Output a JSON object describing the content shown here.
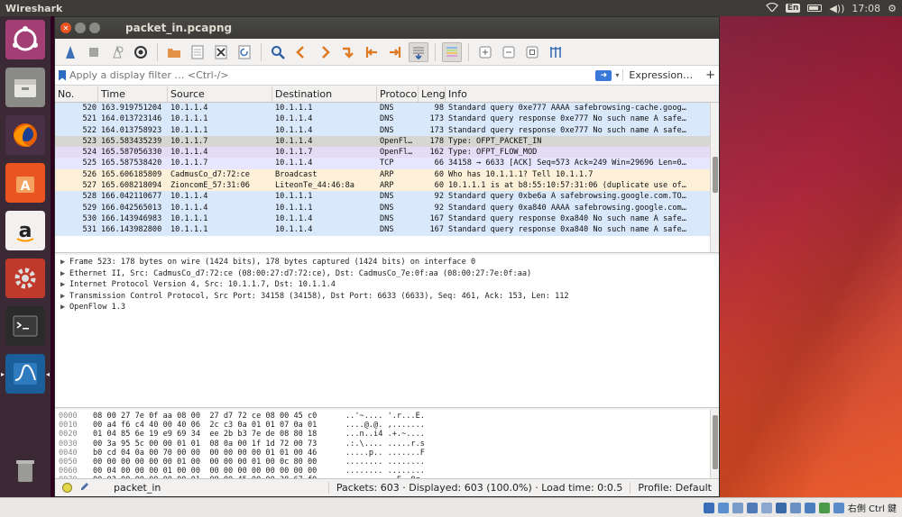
{
  "top_panel": {
    "app_name": "Wireshark",
    "keyboard": "En",
    "volume": "◀))",
    "time": "17:08",
    "settings": "⚙"
  },
  "window": {
    "title": "packet_in.pcapng"
  },
  "filter": {
    "placeholder": "Apply a display filter … <Ctrl-/>",
    "expression_label": "Expression…",
    "plus_label": "+"
  },
  "packet_list": {
    "columns": [
      "No.",
      "Time",
      "Source",
      "Destination",
      "Protocol",
      "Length",
      "Info"
    ],
    "row_colors": {
      "dns": "#dae8fc",
      "openflow": "#e4dcf5",
      "tcp": "#e7e6ff",
      "arp": "#fcf0d9",
      "selected": "#d6d6d2"
    },
    "rows": [
      {
        "no": "520",
        "time": "163.919751204",
        "src": "10.1.1.4",
        "dst": "10.1.1.1",
        "proto": "DNS",
        "len": "98",
        "info": "Standard query 0xe777 AAAA safebrowsing-cache.goog…",
        "kind": "dns"
      },
      {
        "no": "521",
        "time": "164.013723146",
        "src": "10.1.1.1",
        "dst": "10.1.1.4",
        "proto": "DNS",
        "len": "173",
        "info": "Standard query response 0xe777 No such name A safe…",
        "kind": "dns"
      },
      {
        "no": "522",
        "time": "164.013758923",
        "src": "10.1.1.1",
        "dst": "10.1.1.4",
        "proto": "DNS",
        "len": "173",
        "info": "Standard query response 0xe777 No such name A safe…",
        "kind": "dns"
      },
      {
        "no": "523",
        "time": "165.583435239",
        "src": "10.1.1.7",
        "dst": "10.1.1.4",
        "proto": "OpenFl…",
        "len": "178",
        "info": "Type: OFPT_PACKET_IN",
        "kind": "selected"
      },
      {
        "no": "524",
        "time": "165.587056330",
        "src": "10.1.1.4",
        "dst": "10.1.1.7",
        "proto": "OpenFl…",
        "len": "162",
        "info": "Type: OFPT_FLOW_MOD",
        "kind": "openflow"
      },
      {
        "no": "525",
        "time": "165.587538420",
        "src": "10.1.1.7",
        "dst": "10.1.1.4",
        "proto": "TCP",
        "len": "66",
        "info": "34158 → 6633 [ACK] Seq=573 Ack=249 Win=29696 Len=0…",
        "kind": "tcp"
      },
      {
        "no": "526",
        "time": "165.606185809",
        "src": "CadmusCo_d7:72:ce",
        "dst": "Broadcast",
        "proto": "ARP",
        "len": "60",
        "info": "Who has 10.1.1.1? Tell 10.1.1.7",
        "kind": "arp"
      },
      {
        "no": "527",
        "time": "165.608218094",
        "src": "ZioncomE_57:31:06",
        "dst": "LiteonTe_44:46:8a",
        "proto": "ARP",
        "len": "60",
        "info": "10.1.1.1 is at b8:55:10:57:31:06 (duplicate use of…",
        "kind": "arp"
      },
      {
        "no": "528",
        "time": "166.042110677",
        "src": "10.1.1.4",
        "dst": "10.1.1.1",
        "proto": "DNS",
        "len": "92",
        "info": "Standard query 0xbe6a A safebrowsing.google.com.TO…",
        "kind": "dns"
      },
      {
        "no": "529",
        "time": "166.042565013",
        "src": "10.1.1.4",
        "dst": "10.1.1.1",
        "proto": "DNS",
        "len": "92",
        "info": "Standard query 0xa840 AAAA safebrowsing.google.com…",
        "kind": "dns"
      },
      {
        "no": "530",
        "time": "166.143946983",
        "src": "10.1.1.1",
        "dst": "10.1.1.4",
        "proto": "DNS",
        "len": "167",
        "info": "Standard query response 0xa840 No such name A safe…",
        "kind": "dns"
      },
      {
        "no": "531",
        "time": "166.143982800",
        "src": "10.1.1.1",
        "dst": "10.1.1.4",
        "proto": "DNS",
        "len": "167",
        "info": "Standard query response 0xa840 No such name A safe…",
        "kind": "dns"
      }
    ]
  },
  "details": [
    "Frame 523: 178 bytes on wire (1424 bits), 178 bytes captured (1424 bits) on interface 0",
    "Ethernet II, Src: CadmusCo_d7:72:ce (08:00:27:d7:72:ce), Dst: CadmusCo_7e:0f:aa (08:00:27:7e:0f:aa)",
    "Internet Protocol Version 4, Src: 10.1.1.7, Dst: 10.1.1.4",
    "Transmission Control Protocol, Src Port: 34158 (34158), Dst Port: 6633 (6633), Seq: 461, Ack: 153, Len: 112",
    "OpenFlow 1.3"
  ],
  "bytes": [
    {
      "off": "0000",
      "hex": "08 00 27 7e 0f aa 08 00  27 d7 72 ce 08 00 45 c0",
      "ascii": "..'~.... '.r...E."
    },
    {
      "off": "0010",
      "hex": "00 a4 f6 c4 40 00 40 06  2c c3 0a 01 01 07 0a 01",
      "ascii": "....@.@. ,......."
    },
    {
      "off": "0020",
      "hex": "01 04 85 6e 19 e9 69 34  ee 2b b3 7e de 08 80 18",
      "ascii": "...n..i4 .+.~...."
    },
    {
      "off": "0030",
      "hex": "00 3a 95 5c 00 00 01 01  08 0a 00 1f 1d 72 00 73",
      "ascii": ".:.\\.... .....r.s"
    },
    {
      "off": "0040",
      "hex": "b0 cd 04 0a 00 70 00 00  00 00 00 00 01 01 00 46",
      "ascii": ".....p.. .......F"
    },
    {
      "off": "0050",
      "hex": "00 00 00 00 00 00 01 00  00 00 00 01 00 0c 80 00",
      "ascii": "........ ........"
    },
    {
      "off": "0060",
      "hex": "00 04 00 00 00 01 00 00  00 00 00 00 00 00 00 00",
      "ascii": "........ ........"
    },
    {
      "off": "0070",
      "hex": "00 03 00 00 00 00 00 01  08 00 45 00 00 38 67 f0",
      "ascii": "........ ..E..8g."
    }
  ],
  "status": {
    "file": "packet_in",
    "packets": "Packets: 603 · Displayed: 603 (100.0%) · Load time: 0:0.5",
    "profile": "Profile: Default"
  },
  "tray": {
    "label": "右側 Ctrl 鍵"
  }
}
